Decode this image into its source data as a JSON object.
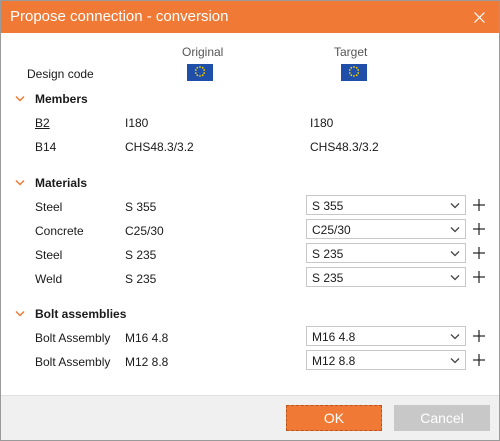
{
  "window": {
    "title": "Propose connection - conversion"
  },
  "header": {
    "original": "Original",
    "target": "Target"
  },
  "design_code": {
    "label": "Design code",
    "original_flag": "eu-flag-icon",
    "target_flag": "eu-flag-icon"
  },
  "members": {
    "title": "Members",
    "rows": [
      {
        "name": "B2",
        "original": "I180",
        "target": "I180"
      },
      {
        "name": "B14",
        "original": "CHS48.3/3.2",
        "target": "CHS48.3/3.2"
      }
    ]
  },
  "materials": {
    "title": "Materials",
    "rows": [
      {
        "name": "Steel",
        "original": "S 355",
        "target": "S 355"
      },
      {
        "name": "Concrete",
        "original": "C25/30",
        "target": "C25/30"
      },
      {
        "name": "Steel",
        "original": "S 235",
        "target": "S 235"
      },
      {
        "name": "Weld",
        "original": "S 235",
        "target": "S 235"
      }
    ]
  },
  "bolts": {
    "title": "Bolt assemblies",
    "rows": [
      {
        "name": "Bolt Assembly",
        "original": "M16 4.8",
        "target": "M16 4.8"
      },
      {
        "name": "Bolt Assembly",
        "original": "M12 8.8",
        "target": "M12 8.8"
      }
    ]
  },
  "footer": {
    "ok_label": "OK",
    "cancel_label": "Cancel"
  },
  "colors": {
    "accent": "#f07a35",
    "flag_blue": "#1f4fa8",
    "flag_stars": "#f5d000",
    "cancel": "#c8c8c8"
  }
}
